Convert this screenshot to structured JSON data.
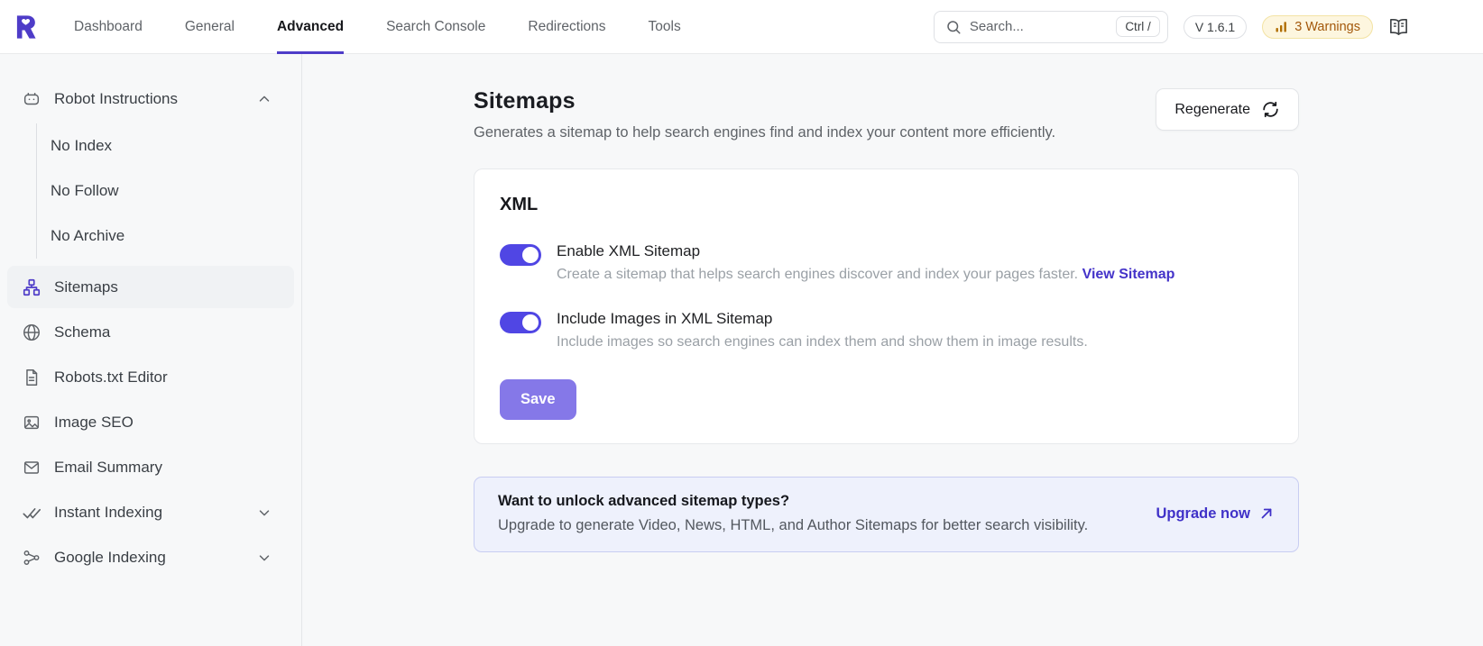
{
  "header": {
    "nav": [
      {
        "label": "Dashboard",
        "active": false
      },
      {
        "label": "General",
        "active": false
      },
      {
        "label": "Advanced",
        "active": true
      },
      {
        "label": "Search Console",
        "active": false
      },
      {
        "label": "Redirections",
        "active": false
      },
      {
        "label": "Tools",
        "active": false
      }
    ],
    "search": {
      "placeholder": "Search...",
      "shortcut": "Ctrl /"
    },
    "version_badge": "V 1.6.1",
    "warnings_badge": "3 Warnings"
  },
  "sidebar": {
    "items": [
      {
        "label": "Robot Instructions",
        "icon": "robot-icon",
        "expanded": true,
        "children": [
          "No Index",
          "No Follow",
          "No Archive"
        ]
      },
      {
        "label": "Sitemaps",
        "icon": "sitemap-icon",
        "active": true
      },
      {
        "label": "Schema",
        "icon": "globe-icon"
      },
      {
        "label": "Robots.txt Editor",
        "icon": "document-icon"
      },
      {
        "label": "Image SEO",
        "icon": "image-icon"
      },
      {
        "label": "Email Summary",
        "icon": "mail-icon"
      },
      {
        "label": "Instant Indexing",
        "icon": "double-check-icon",
        "expanded": false
      },
      {
        "label": "Google Indexing",
        "icon": "share-network-icon",
        "expanded": false
      }
    ]
  },
  "main": {
    "title": "Sitemaps",
    "description": "Generates a sitemap to help search engines find and index your content more efficiently.",
    "regenerate_label": "Regenerate",
    "card": {
      "heading": "XML",
      "settings": [
        {
          "label": "Enable XML Sitemap",
          "description": "Create a sitemap that helps search engines discover and index your pages faster.",
          "link": "View Sitemap",
          "enabled": true
        },
        {
          "label": "Include Images in XML Sitemap",
          "description": "Include images so search engines can index them and show them in image results.",
          "enabled": true
        }
      ],
      "save_label": "Save"
    },
    "upsell": {
      "title": "Want to unlock advanced sitemap types?",
      "description": "Upgrade to generate Video, News, HTML, and Author Sitemaps for better search visibility.",
      "cta": "Upgrade now"
    }
  },
  "colors": {
    "accent": "#4e3cc8",
    "toggle_on": "#5046e4",
    "save_button": "#8578e8",
    "link": "#4433c9",
    "warning_text": "#a3580b",
    "warning_bg": "#fdf6df",
    "upsell_bg": "#eef1fc"
  }
}
